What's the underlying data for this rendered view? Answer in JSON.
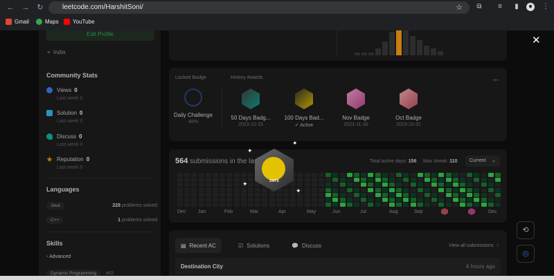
{
  "browser": {
    "url": "leetcode.com/HarshitSoni/",
    "bookmarks": [
      "Gmail",
      "Maps",
      "YouTube"
    ]
  },
  "profile": {
    "edit_label": "Edit Profile",
    "location": "India"
  },
  "community": {
    "title": "Community Stats",
    "items": [
      {
        "label": "Views",
        "value": "0",
        "sub": "Last week 0",
        "color": "#3b82f6"
      },
      {
        "label": "Solution",
        "value": "0",
        "sub": "Last week 0",
        "color": "#38bdf8"
      },
      {
        "label": "Discuss",
        "value": "0",
        "sub": "Last week 0",
        "color": "#14b8a6"
      },
      {
        "label": "Reputation",
        "value": "0",
        "sub": "Last week 0",
        "color": "#f59e0b"
      }
    ]
  },
  "languages": {
    "title": "Languages",
    "items": [
      {
        "name": "Java",
        "count": "228",
        "suffix": "problems solved"
      },
      {
        "name": "C++",
        "count": "1",
        "suffix": "problems solved"
      }
    ]
  },
  "skills": {
    "title": "Skills",
    "level": "Advanced",
    "tag": "Dynamic Programming",
    "tag_count": "x63"
  },
  "badges": {
    "locked_label": "Locked Badge",
    "history_label": "History Awards",
    "items": [
      {
        "name": "Daily Challenge",
        "date": "48%",
        "color": "#1e3a5f"
      },
      {
        "name": "50 Days Badg...",
        "date": "2023-12-15",
        "color": "#0f9e8f"
      },
      {
        "name": "100 Days Bad...",
        "date": "Active",
        "color": "#e5c200"
      },
      {
        "name": "Nov Badge",
        "date": "2023-11-30",
        "color": "#c2448e"
      },
      {
        "name": "Oct Badge",
        "date": "2023-10-31",
        "color": "#c45060"
      }
    ]
  },
  "submissions": {
    "count": "564",
    "text": "submissions in the last",
    "active_label": "Total active days:",
    "active_days": "156",
    "streak_label": "Max streak:",
    "streak": "110",
    "select": "Current",
    "months": [
      "Dec",
      "Jan",
      "Feb",
      "Mar",
      "Apr",
      "May",
      "Jun",
      "Jul",
      "Aug",
      "Sep",
      "Dec"
    ]
  },
  "tabs": {
    "recent": "Recent AC",
    "solutions": "Solutions",
    "discuss": "Discuss",
    "view_all": "View all submissions"
  },
  "recent": {
    "title": "Destination City",
    "time": "4 hours ago"
  },
  "overlay": {
    "badge_text": "DAYS"
  }
}
